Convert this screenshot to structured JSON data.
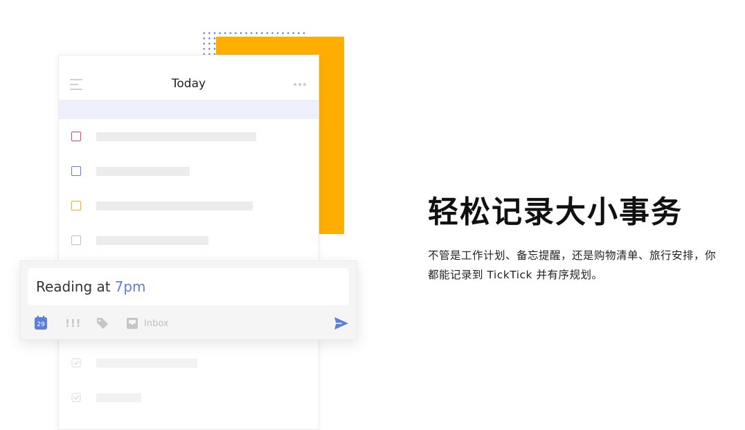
{
  "phone": {
    "title": "Today"
  },
  "quick_add": {
    "text": "Reading at",
    "time": "7pm",
    "date_badge": "29",
    "priority_icon": "!!!",
    "list_label": "Inbox"
  },
  "hero": {
    "headline": "轻松记录大小事务",
    "description": "不管是工作计划、备忘提醒，还是购物清单、旅行安排，你都能记录到 TickTick 并有序规划。"
  },
  "colors": {
    "accent_blue": "#5b7fd6",
    "accent_orange": "#ffae00",
    "priority_high": "#e5407b",
    "priority_medium": "#5b7fd6",
    "priority_low": "#f5b400",
    "priority_none": "#bdbdbd"
  },
  "icons": [
    "menu-icon",
    "more-icon",
    "calendar-icon",
    "priority-icon",
    "tag-icon",
    "inbox-icon",
    "send-icon",
    "check-icon"
  ]
}
